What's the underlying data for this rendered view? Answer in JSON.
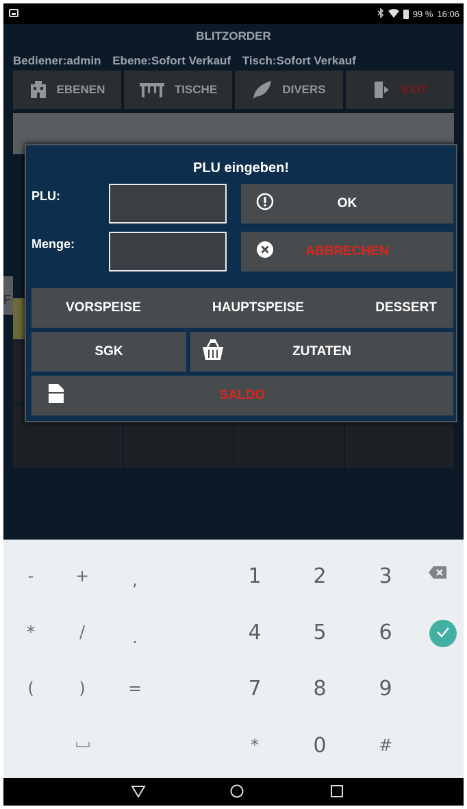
{
  "status_bar": {
    "battery": "99 %",
    "time": "16:06",
    "icons": [
      "notification-icon",
      "bluetooth-icon",
      "wifi-icon",
      "battery-icon"
    ]
  },
  "app": {
    "title": "BLITZORDER",
    "operator": "Bediener:admin",
    "level": "Ebene:Sofort Verkauf",
    "table": "Tisch:Sofort Verkauf",
    "toolbar": {
      "levels": "EBENEN",
      "tables": "TISCHE",
      "misc": "DIVERS",
      "exit": "EXIT"
    },
    "grid_partial_char": "F"
  },
  "dialog": {
    "title": "PLU eingeben!",
    "plu_label": "PLU:",
    "plu_value": "",
    "quantity_label": "Menge:",
    "quantity_value": "",
    "ok_label": "OK",
    "cancel_label": "ABBRECHEN",
    "categories": [
      "VORSPEISE",
      "HAUPTSPEISE",
      "DESSERT"
    ],
    "sgk_label": "SGK",
    "ingredients_label": "ZUTATEN",
    "balance_label": "SALDO"
  },
  "keyboard": {
    "rows": [
      [
        "-",
        "+",
        ",",
        "1",
        "2",
        "3"
      ],
      [
        "*",
        "/",
        ".",
        "4",
        "5",
        "6"
      ],
      [
        "(",
        ")",
        "=",
        "7",
        "8",
        "9"
      ],
      [
        "",
        "",
        "",
        "*",
        "0",
        "#"
      ]
    ]
  },
  "colors": {
    "dialog_bg": "#0d2f4d",
    "button_bg": "#484b4e",
    "danger": "#d8261e",
    "keyboard_bg": "#eceff1",
    "enter_key": "#41b0a3"
  }
}
